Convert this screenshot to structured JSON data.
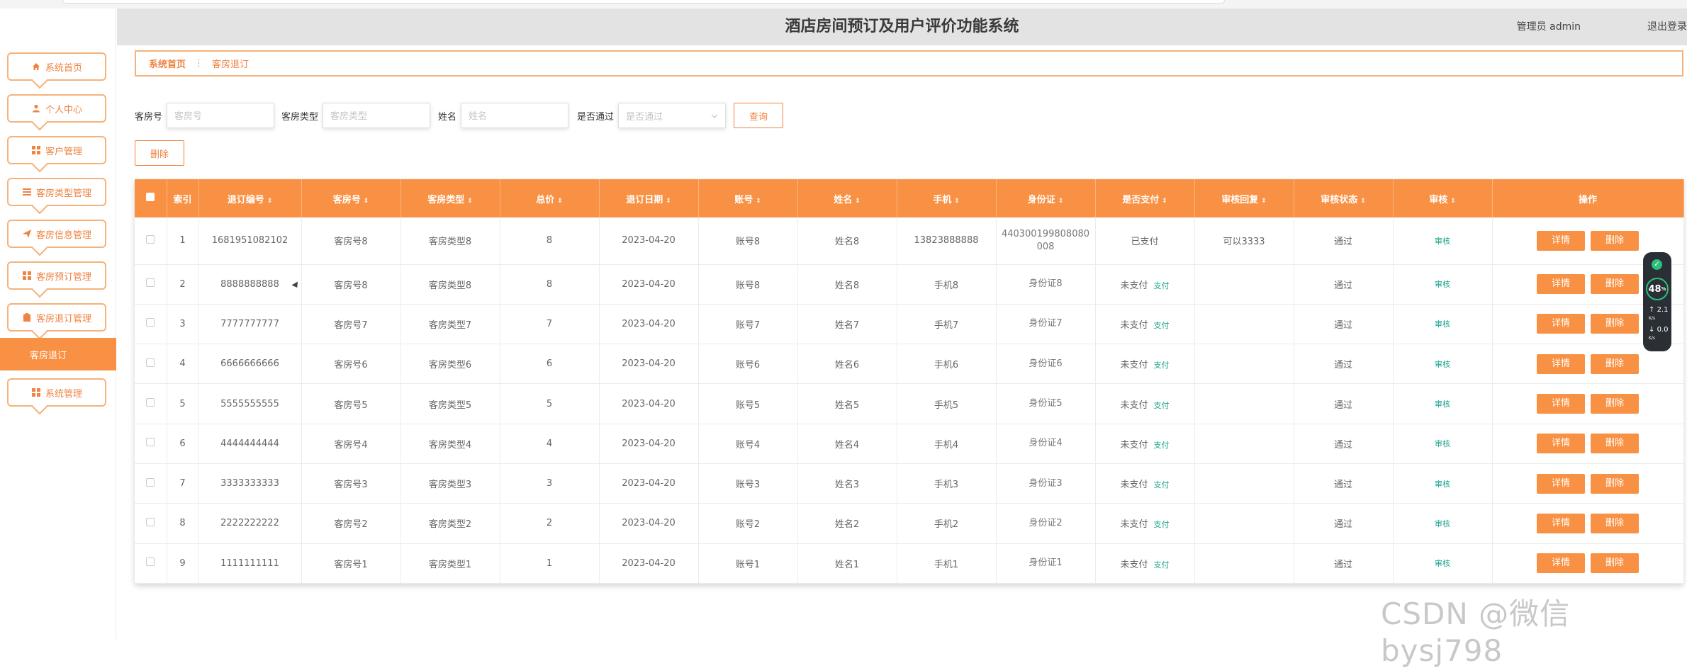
{
  "header": {
    "title": "酒店房间预订及用户评价功能系统",
    "user": "管理员 admin",
    "logout": "退出登录"
  },
  "sidebar": {
    "items": [
      {
        "label": "系统首页",
        "icon": "home-icon"
      },
      {
        "label": "个人中心",
        "icon": "user-icon"
      },
      {
        "label": "客户管理",
        "icon": "grid-icon"
      },
      {
        "label": "客房类型管理",
        "icon": "list-icon"
      },
      {
        "label": "客房信息管理",
        "icon": "send-icon"
      },
      {
        "label": "客房预订管理",
        "icon": "grid-icon"
      },
      {
        "label": "客房退订管理",
        "icon": "clipboard-icon"
      },
      {
        "label": "客房退订",
        "icon": ""
      },
      {
        "label": "系统管理",
        "icon": "grid-icon"
      }
    ]
  },
  "breadcrumb": {
    "home": "系统首页",
    "separator": "⋮",
    "current": "客房退订"
  },
  "search": {
    "room_no_label": "客房号",
    "room_no_placeholder": "客房号",
    "room_type_label": "客房类型",
    "room_type_placeholder": "客房类型",
    "name_label": "姓名",
    "name_placeholder": "姓名",
    "pass_label": "是否通过",
    "pass_placeholder": "是否通过",
    "query_button": "查询",
    "delete_button": "删除"
  },
  "table": {
    "columns": [
      "索引",
      "退订编号",
      "客房号",
      "客房类型",
      "总价",
      "退订日期",
      "账号",
      "姓名",
      "手机",
      "身份证",
      "是否支付",
      "审核回复",
      "审核状态",
      "审核",
      "操作"
    ],
    "rows": [
      {
        "index": "1",
        "order_no": "1681951082102",
        "room_no": "客房号8",
        "room_type": "客房类型8",
        "price": "8",
        "date": "2023-04-20",
        "account": "账号8",
        "name": "姓名8",
        "phone": "13823888888",
        "id_card": "440300199808080008",
        "paid": "已支付",
        "pay_link": "",
        "reply": "可以3333",
        "status": "通过",
        "audit": "审核"
      },
      {
        "index": "2",
        "order_no": "8888888888",
        "room_no": "客房号8",
        "room_type": "客房类型8",
        "price": "8",
        "date": "2023-04-20",
        "account": "账号8",
        "name": "姓名8",
        "phone": "手机8",
        "id_card": "身份证8",
        "paid": "未支付",
        "pay_link": "支付",
        "reply": "",
        "status": "通过",
        "audit": "审核"
      },
      {
        "index": "3",
        "order_no": "7777777777",
        "room_no": "客房号7",
        "room_type": "客房类型7",
        "price": "7",
        "date": "2023-04-20",
        "account": "账号7",
        "name": "姓名7",
        "phone": "手机7",
        "id_card": "身份证7",
        "paid": "未支付",
        "pay_link": "支付",
        "reply": "",
        "status": "通过",
        "audit": "审核"
      },
      {
        "index": "4",
        "order_no": "6666666666",
        "room_no": "客房号6",
        "room_type": "客房类型6",
        "price": "6",
        "date": "2023-04-20",
        "account": "账号6",
        "name": "姓名6",
        "phone": "手机6",
        "id_card": "身份证6",
        "paid": "未支付",
        "pay_link": "支付",
        "reply": "",
        "status": "通过",
        "audit": "审核"
      },
      {
        "index": "5",
        "order_no": "5555555555",
        "room_no": "客房号5",
        "room_type": "客房类型5",
        "price": "5",
        "date": "2023-04-20",
        "account": "账号5",
        "name": "姓名5",
        "phone": "手机5",
        "id_card": "身份证5",
        "paid": "未支付",
        "pay_link": "支付",
        "reply": "",
        "status": "通过",
        "audit": "审核"
      },
      {
        "index": "6",
        "order_no": "4444444444",
        "room_no": "客房号4",
        "room_type": "客房类型4",
        "price": "4",
        "date": "2023-04-20",
        "account": "账号4",
        "name": "姓名4",
        "phone": "手机4",
        "id_card": "身份证4",
        "paid": "未支付",
        "pay_link": "支付",
        "reply": "",
        "status": "通过",
        "audit": "审核"
      },
      {
        "index": "7",
        "order_no": "3333333333",
        "room_no": "客房号3",
        "room_type": "客房类型3",
        "price": "3",
        "date": "2023-04-20",
        "account": "账号3",
        "name": "姓名3",
        "phone": "手机3",
        "id_card": "身份证3",
        "paid": "未支付",
        "pay_link": "支付",
        "reply": "",
        "status": "通过",
        "audit": "审核"
      },
      {
        "index": "8",
        "order_no": "2222222222",
        "room_no": "客房号2",
        "room_type": "客房类型2",
        "price": "2",
        "date": "2023-04-20",
        "account": "账号2",
        "name": "姓名2",
        "phone": "手机2",
        "id_card": "身份证2",
        "paid": "未支付",
        "pay_link": "支付",
        "reply": "",
        "status": "通过",
        "audit": "审核"
      },
      {
        "index": "9",
        "order_no": "1111111111",
        "room_no": "客房号1",
        "room_type": "客房类型1",
        "price": "1",
        "date": "2023-04-20",
        "account": "账号1",
        "name": "姓名1",
        "phone": "手机1",
        "id_card": "身份证1",
        "paid": "未支付",
        "pay_link": "支付",
        "reply": "",
        "status": "通过",
        "audit": "审核"
      }
    ],
    "detail_button": "详情",
    "delete_button": "删除"
  },
  "widget": {
    "percent": "48",
    "unit": "%",
    "up": "2.1",
    "up_unit": "K/s",
    "down": "0.0",
    "down_unit": "K/s"
  },
  "watermark": "CSDN @微信bysj798",
  "colors": {
    "accent": "#f99144",
    "accent_border": "#f6b27a",
    "link": "#1aa38c",
    "header_bg": "#e3e3e3"
  }
}
